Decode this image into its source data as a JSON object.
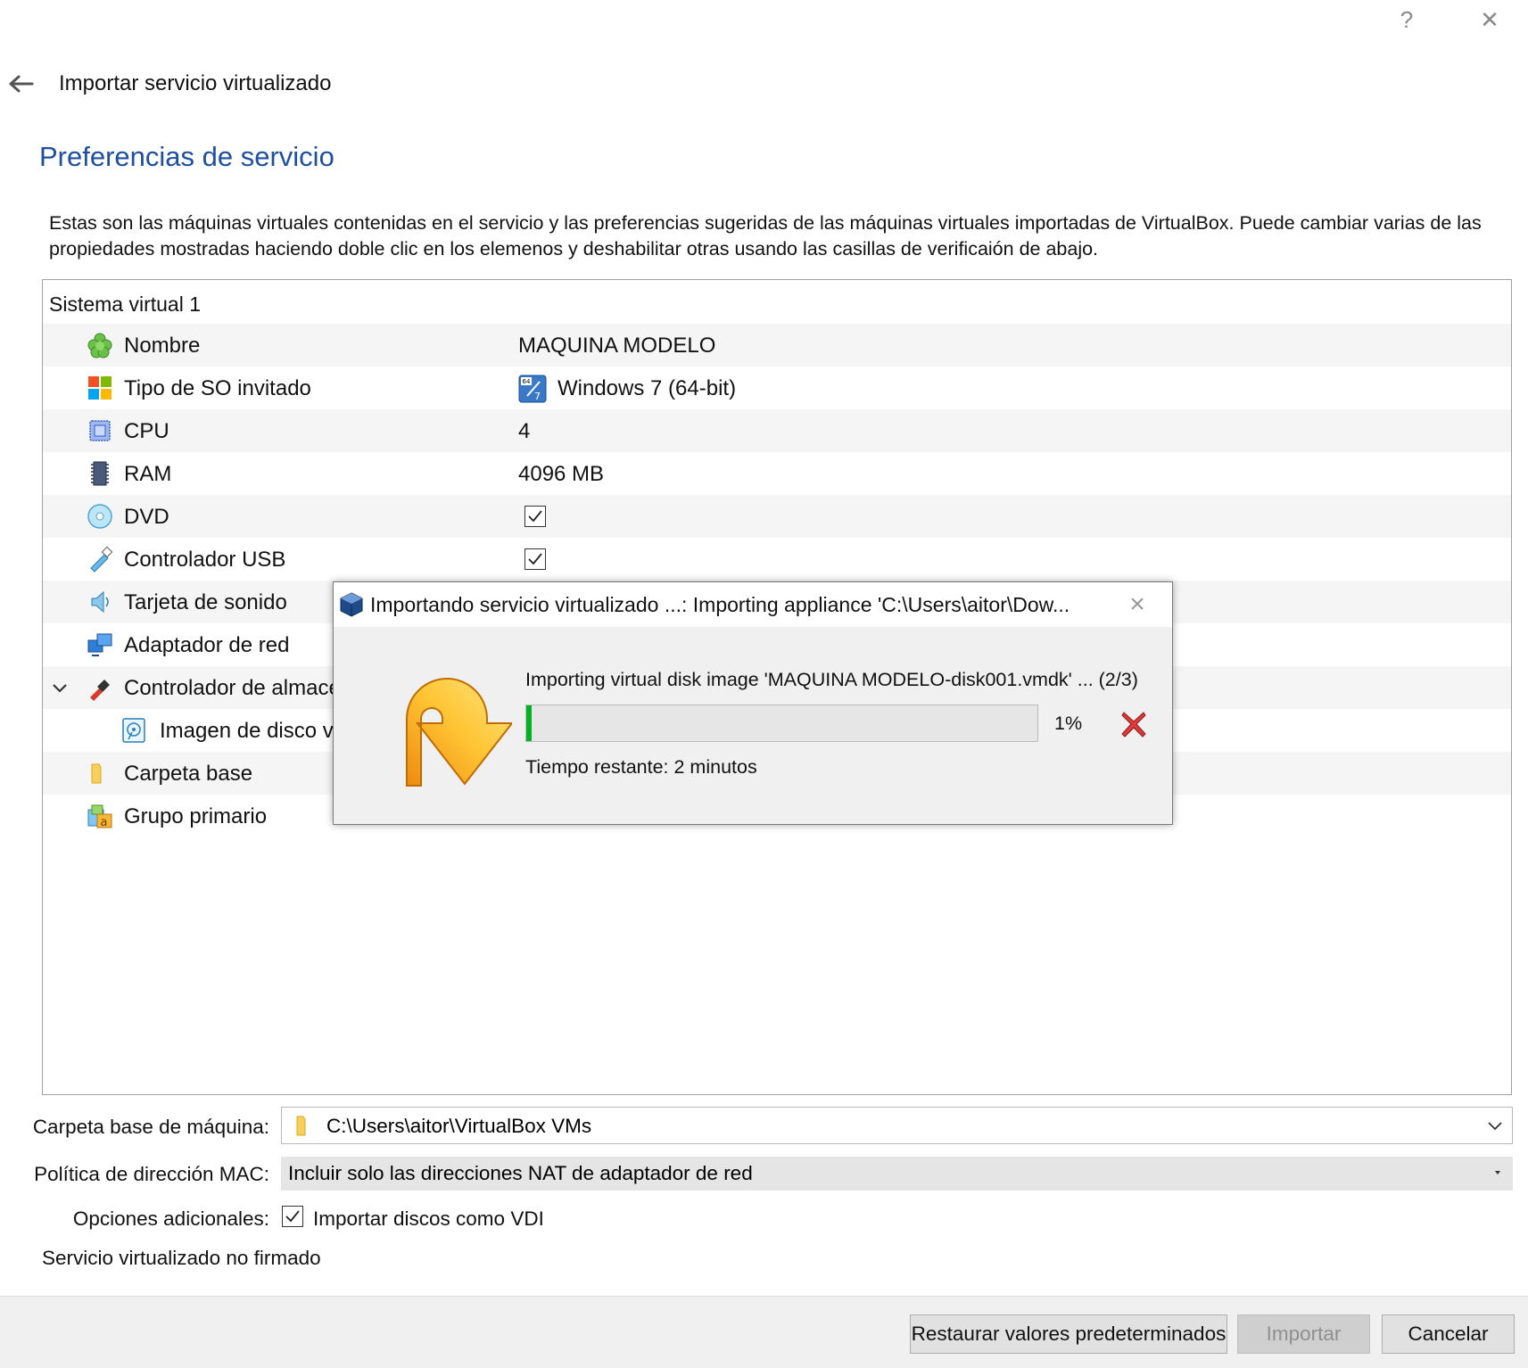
{
  "titlebar": {
    "help_label": "?",
    "close_label": "✕"
  },
  "wizard": {
    "title": "Importar servicio virtualizado",
    "page_title": "Preferencias de servicio",
    "description": "Estas son las máquinas virtuales contenidas en el servicio y las preferencias sugeridas de las máquinas virtuales importadas de VirtualBox. Puede cambiar varias de las propiedades mostradas haciendo doble clic en los elemenos y deshabilitar otras usando las casillas de verificaión de abajo."
  },
  "tree": {
    "header": "Sistema virtual 1",
    "rows": [
      {
        "label": "Nombre",
        "value": "MAQUINA MODELO",
        "icon": "name-icon"
      },
      {
        "label": "Tipo de SO invitado",
        "value": "Windows 7 (64-bit)",
        "icon": "os-icon"
      },
      {
        "label": "CPU",
        "value": "4",
        "icon": "cpu-icon"
      },
      {
        "label": "RAM",
        "value": "4096 MB",
        "icon": "ram-icon"
      },
      {
        "label": "DVD",
        "value": "",
        "checked": true,
        "icon": "dvd-icon"
      },
      {
        "label": "Controlador USB",
        "value": "",
        "checked": true,
        "icon": "usb-icon"
      },
      {
        "label": "Tarjeta de sonido",
        "value": "",
        "icon": "sound-icon"
      },
      {
        "label": "Adaptador de red",
        "value": "",
        "icon": "network-icon"
      },
      {
        "label": "Controlador de almace",
        "value": "",
        "icon": "storage-controller-icon"
      },
      {
        "label": "Imagen de disco vi",
        "value": "",
        "icon": "disk-image-icon"
      },
      {
        "label": "Carpeta base",
        "value": "",
        "icon": "folder-icon"
      },
      {
        "label": "Grupo primario",
        "value": "/",
        "icon": "group-icon"
      }
    ]
  },
  "progress_dialog": {
    "title": "Importando servicio virtualizado ...: Importing appliance 'C:\\Users\\aitor\\Dow...",
    "operation": "Importing virtual disk image 'MAQUINA MODELO-disk001.vmdk' ... (2/3)",
    "percent_label": "1%",
    "progress_fraction": 0.01,
    "time_remaining": "Tiempo restante: 2 minutos"
  },
  "form": {
    "base_folder_label": "Carpeta base de máquina:",
    "base_folder_value": "C:\\Users\\aitor\\VirtualBox VMs",
    "mac_policy_label": "Política de dirección MAC:",
    "mac_policy_value": "Incluir solo las direcciones NAT de adaptador de red",
    "extra_options_label": "Opciones adicionales:",
    "import_vdi_label": "Importar discos como VDI",
    "import_vdi_checked": true,
    "signature_status": "Servicio virtualizado no firmado"
  },
  "buttons": {
    "restore": "Restaurar valores predeterminados",
    "import": "Importar",
    "cancel": "Cancelar"
  },
  "colors": {
    "accent": "#1e4fa0",
    "progress": "#06b025"
  }
}
